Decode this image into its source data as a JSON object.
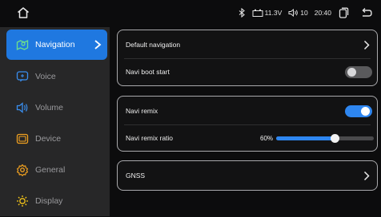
{
  "status_bar": {
    "voltage": "11.3V",
    "volume": "10",
    "time": "20:40",
    "icons": [
      "home-icon",
      "bluetooth-icon",
      "battery-icon",
      "speaker-icon",
      "recent-apps-icon",
      "back-icon"
    ]
  },
  "sidebar": {
    "items": [
      {
        "label": "Navigation",
        "icon": "navigation-icon",
        "active": true
      },
      {
        "label": "Voice",
        "icon": "voice-icon"
      },
      {
        "label": "Volume",
        "icon": "volume-icon"
      },
      {
        "label": "Device",
        "icon": "device-icon"
      },
      {
        "label": "General",
        "icon": "gear-icon"
      },
      {
        "label": "Display",
        "icon": "brightness-icon"
      }
    ]
  },
  "content": {
    "default_navigation": "Default navigation",
    "navi_boot_start": {
      "label": "Navi boot start",
      "enabled": false
    },
    "navi_remix": {
      "label": "Navi remix",
      "enabled": true
    },
    "navi_remix_ratio": {
      "label": "Navi remix ratio",
      "value_text": "60%",
      "fraction": 0.6
    },
    "gnss": "GNSS"
  },
  "colors": {
    "accent": "#1f78e0",
    "sidebar_bg": "#272728",
    "bg": "#0c0c0d",
    "card_border": "#a9a9ac"
  }
}
